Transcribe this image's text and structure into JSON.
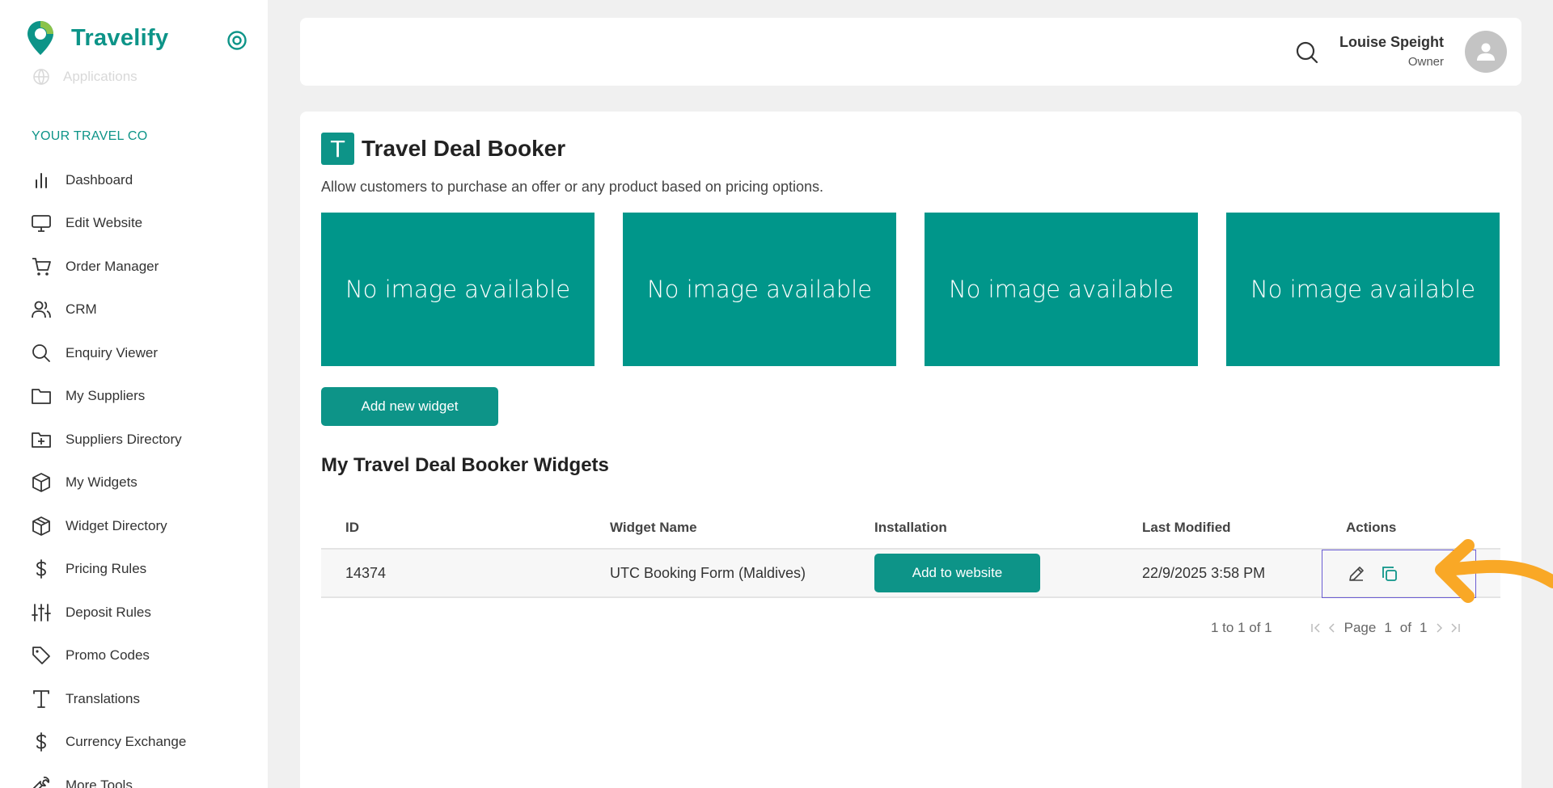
{
  "brand": {
    "name": "Travelify",
    "logo_icon": "location-pin-icon",
    "collapse_icon": "target-icon"
  },
  "sidebar": {
    "faded_item": "Applications",
    "section_title": "YOUR TRAVEL CO",
    "items": [
      {
        "label": "Dashboard",
        "icon": "bar-chart-icon"
      },
      {
        "label": "Edit Website",
        "icon": "monitor-icon"
      },
      {
        "label": "Order Manager",
        "icon": "cart-icon"
      },
      {
        "label": "CRM",
        "icon": "users-icon"
      },
      {
        "label": "Enquiry Viewer",
        "icon": "search-icon"
      },
      {
        "label": "My Suppliers",
        "icon": "folder-icon"
      },
      {
        "label": "Suppliers Directory",
        "icon": "folder-plus-icon"
      },
      {
        "label": "My Widgets",
        "icon": "box-icon"
      },
      {
        "label": "Widget Directory",
        "icon": "boxes-icon"
      },
      {
        "label": "Pricing Rules",
        "icon": "dollar-icon"
      },
      {
        "label": "Deposit Rules",
        "icon": "sliders-icon"
      },
      {
        "label": "Promo Codes",
        "icon": "tag-icon"
      },
      {
        "label": "Translations",
        "icon": "type-icon"
      },
      {
        "label": "Currency Exchange",
        "icon": "dollar-icon"
      },
      {
        "label": "More Tools",
        "icon": "wrench-icon"
      }
    ]
  },
  "header": {
    "user_name": "Louise Speight",
    "user_role": "Owner"
  },
  "main": {
    "badge_letter": "T",
    "title": "Travel Deal Booker",
    "description": "Allow customers to purchase an offer or any product based on pricing options.",
    "thumbnails": [
      "No image available",
      "No image available",
      "No image available",
      "No image available"
    ],
    "add_widget_label": "Add new widget",
    "section_heading": "My Travel Deal Booker Widgets",
    "table": {
      "columns": [
        "ID",
        "Widget Name",
        "Installation",
        "Last Modified",
        "Actions"
      ],
      "rows": [
        {
          "id": "14374",
          "name": "UTC Booking Form (Maldives)",
          "install_label": "Add to website",
          "modified": "22/9/2025 3:58 PM"
        }
      ]
    },
    "pagination": {
      "range": "1 to 1 of 1",
      "page_label": "Page",
      "current": "1",
      "of_label": "of",
      "total": "1"
    }
  },
  "colors": {
    "accent": "#0d9488",
    "thumb": "#00968a",
    "highlight": "#6b5dd3",
    "arrow": "#f9a826"
  }
}
